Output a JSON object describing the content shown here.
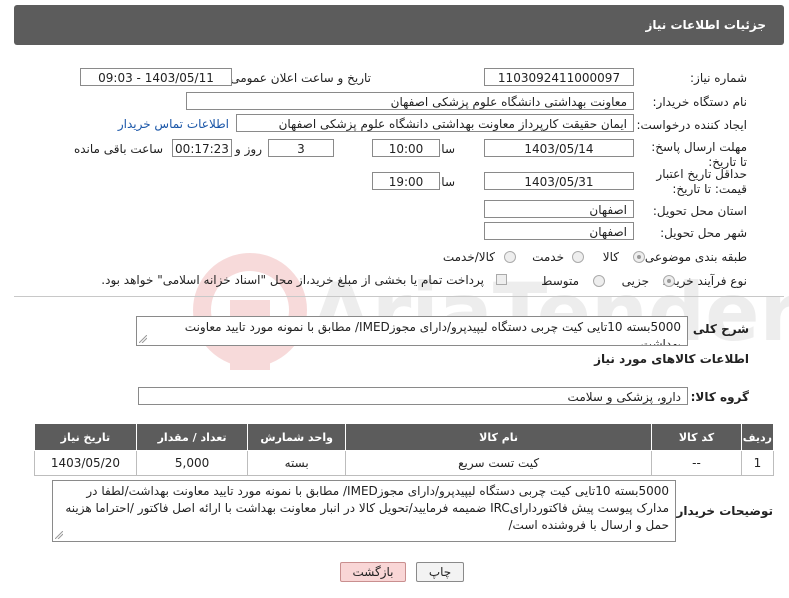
{
  "header": {
    "title": "جزئیات اطلاعات نیاز"
  },
  "fields": {
    "need_number_label": "شماره نیاز:",
    "need_number": "1103092411000097",
    "announce_label": "تاریخ و ساعت اعلان عمومی:",
    "announce_value": "1403/05/11 - 09:03",
    "buyer_label": "نام دستگاه خریدار:",
    "buyer": "معاونت بهداشتی دانشگاه علوم پزشکی اصفهان",
    "creator_label": "ایجاد کننده درخواست:",
    "creator": "ایمان حقیقت کارپرداز معاونت بهداشتی دانشگاه علوم پزشکی اصفهان",
    "contact_link": "اطلاعات تماس خریدار",
    "deadline_label": "مهلت ارسال پاسخ: تا تاریخ:",
    "deadline_date": "1403/05/14",
    "time_label": "ساعت",
    "deadline_time": "10:00",
    "days_value": "3",
    "days_label": "روز و",
    "remaining_time": "00:17:23",
    "remaining_label": "ساعت باقی مانده",
    "validity_label": "حداقل تاریخ اعتبار قیمت: تا تاریخ:",
    "validity_date": "1403/05/31",
    "validity_time": "19:00",
    "province_label": "استان محل تحویل:",
    "province": "اصفهان",
    "city_label": "شهر محل تحویل:",
    "city": "اصفهان",
    "category_label": "طبقه بندی موضوعی:",
    "category_options": [
      "کالا",
      "خدمت",
      "کالا/خدمت"
    ],
    "process_label": "نوع فرآیند خرید :",
    "process_options": [
      "جزیی",
      "متوسط"
    ],
    "process_note": "پرداخت تمام یا بخشی از مبلغ خرید،از محل \"اسناد خزانه اسلامی\" خواهد بود."
  },
  "description": {
    "label": "شرح کلی نیاز:",
    "text": "5000بسته 10تایی کیت چربی دستگاه لیپیدپرو/دارای مجوزIMED/ مطابق با نمونه مورد تایید معاونت بهداشت"
  },
  "goods_section": {
    "title": "اطلاعات کالاهای مورد نیاز",
    "group_label": "گروه کالا:",
    "group_value": "دارو، پزشکی و سلامت"
  },
  "table": {
    "headers": [
      "ردیف",
      "کد کالا",
      "نام کالا",
      "واحد شمارش",
      "تعداد / مقدار",
      "تاریخ نیاز"
    ],
    "rows": [
      [
        "1",
        "--",
        "کیت تست سریع",
        "بسته",
        "5,000",
        "1403/05/20"
      ]
    ]
  },
  "buyer_notes": {
    "label": "توضیحات خریدار:",
    "text": "5000بسته 10تایی کیت چربی دستگاه لیپیدپرو/دارای مجوزIMED/ مطابق با نمونه مورد تایید معاونت بهداشت/لطفا در مدارک پیوست پیش فاکتوردارایIRC ضمیمه فرمایید/تحویل کالا در انبار معاونت بهداشت با ارائه اصل فاکتور /احتراما هزینه حمل و ارسال با فروشنده است/"
  },
  "buttons": {
    "print": "چاپ",
    "back": "بازگشت"
  },
  "watermark": {
    "text": "AriaTender.neT"
  }
}
